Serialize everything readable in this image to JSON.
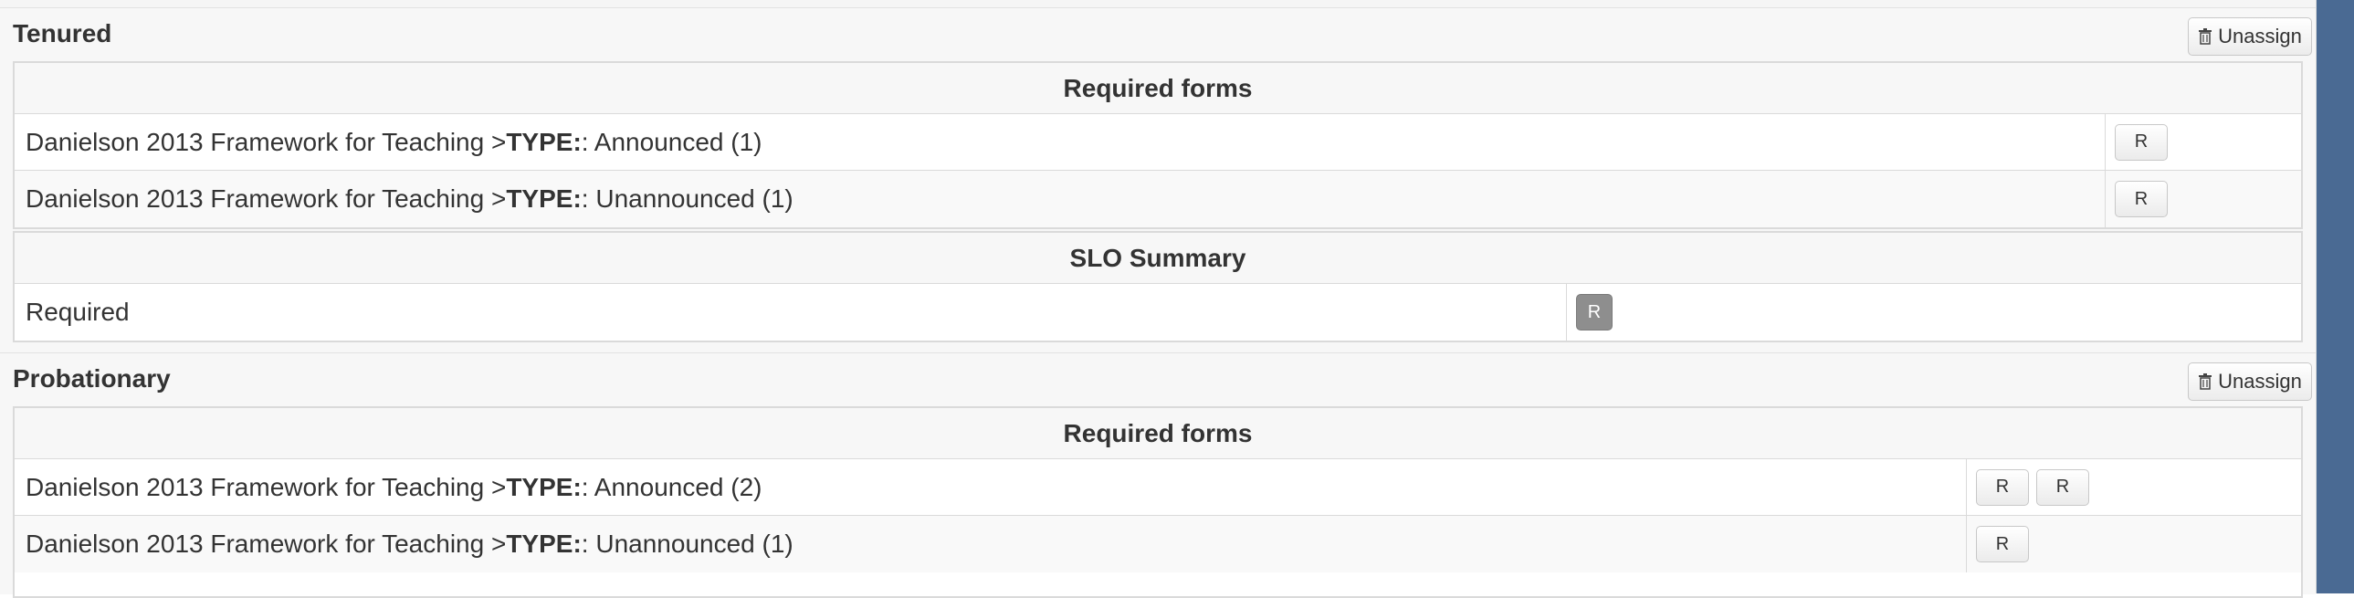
{
  "groups": [
    {
      "title": "Tenured",
      "unassign_label": "Unassign",
      "required_forms": {
        "header": "Required forms",
        "rows": [
          {
            "prefix": "Danielson 2013 Framework for Teaching > ",
            "type_label": "TYPE:",
            "suffix": ": Announced (1)",
            "actions": [
              "R"
            ]
          },
          {
            "prefix": "Danielson 2013 Framework for Teaching > ",
            "type_label": "TYPE:",
            "suffix": ": Unannounced (1)",
            "actions": [
              "R"
            ]
          }
        ]
      },
      "slo_summary": {
        "header": "SLO Summary",
        "rows": [
          {
            "label": "Required",
            "actions": [
              "R"
            ]
          }
        ]
      }
    },
    {
      "title": "Probationary",
      "unassign_label": "Unassign",
      "required_forms": {
        "header": "Required forms",
        "rows": [
          {
            "prefix": "Danielson 2013 Framework for Teaching > ",
            "type_label": "TYPE:",
            "suffix": ": Announced (2)",
            "actions": [
              "R",
              "R"
            ]
          },
          {
            "prefix": "Danielson 2013 Framework for Teaching > ",
            "type_label": "TYPE:",
            "suffix": ": Unannounced (1)",
            "actions": [
              "R"
            ]
          }
        ]
      }
    }
  ]
}
